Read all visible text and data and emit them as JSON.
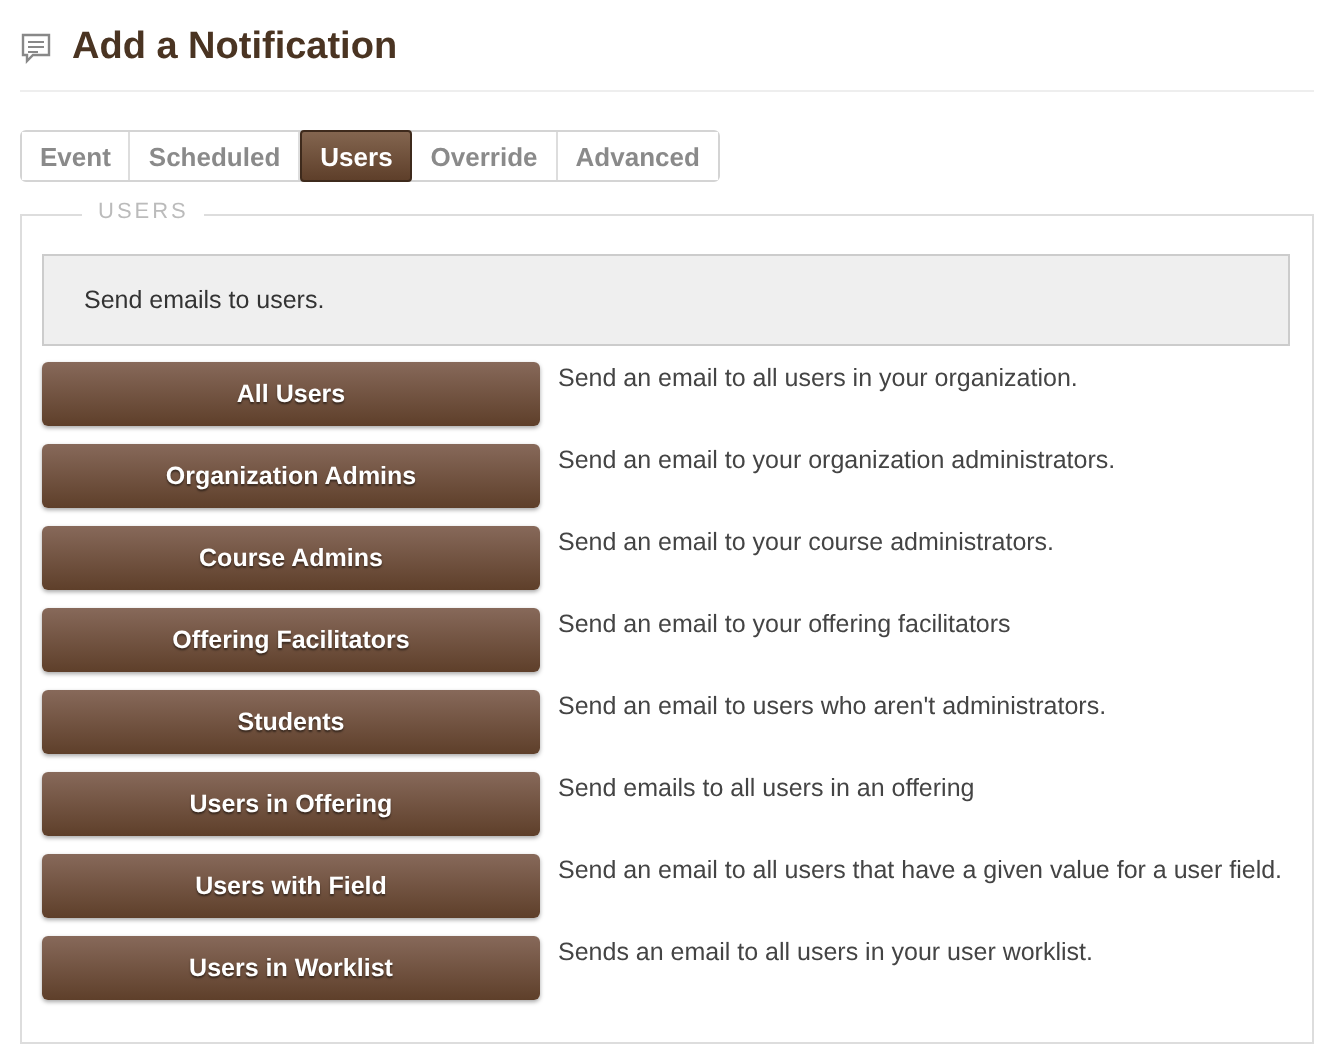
{
  "page": {
    "title": "Add a Notification"
  },
  "tabs": [
    {
      "label": "Event",
      "selected": false
    },
    {
      "label": "Scheduled",
      "selected": false
    },
    {
      "label": "Users",
      "selected": true
    },
    {
      "label": "Override",
      "selected": false
    },
    {
      "label": "Advanced",
      "selected": false
    }
  ],
  "section": {
    "legend": "USERS",
    "info": "Send emails to users.",
    "options": [
      {
        "button": "All Users",
        "description": "Send an email to all users in your organization."
      },
      {
        "button": "Organization Admins",
        "description": "Send an email to your organization administrators."
      },
      {
        "button": "Course Admins",
        "description": "Send an email to your course administrators."
      },
      {
        "button": "Offering Facilitators",
        "description": "Send an email to your offering facilitators"
      },
      {
        "button": "Students",
        "description": "Send an email to users who aren't administrators."
      },
      {
        "button": "Users in Offering",
        "description": "Send emails to all users in an offering"
      },
      {
        "button": "Users with Field",
        "description": "Send an email to all users that have a given value for a user field."
      },
      {
        "button": "Users in Worklist",
        "description": "Sends an email to all users in your user worklist."
      }
    ]
  }
}
